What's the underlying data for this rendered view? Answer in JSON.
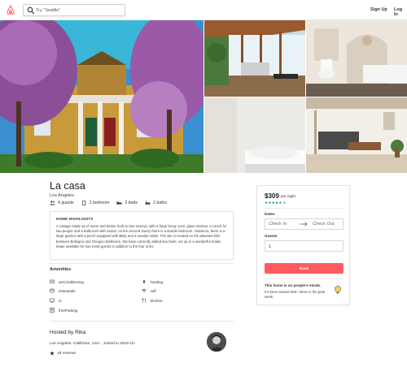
{
  "header": {
    "search_placeholder": "Try \"Seattle\"",
    "signup_label": "Sign Up",
    "login_label": "Log In"
  },
  "listing": {
    "title": "La casa",
    "city": "Los Angeles",
    "stats": {
      "guests": "4 guests",
      "bedrooms": "2 bedroom",
      "beds": "2 beds",
      "baths": "1 baths"
    },
    "highlights_title": "HOME HIGHLIGHTS",
    "highlights_text": "A cottage made up of stone and timber built on two storeys, with a large living room, glass window, a couch for two people and a bathroom with sauna; on the second storey there is a double bedroom. Outdoors, there is a large garden with a porch equipped with BBQ and a wooden table. The site is located on the pleasant hills between Bollegno and Ozegnio Biolbrone. We have currently added two beds, set up in a wonderful Indian leape available for two extra guests in addition to the four ones."
  },
  "amenities": {
    "title": "Amenities",
    "items": [
      {
        "label": "airConditioning",
        "icon": "snowflake-icon"
      },
      {
        "label": "heating",
        "icon": "heating-icon"
      },
      {
        "label": "essentials",
        "icon": "essentials-icon"
      },
      {
        "label": "wifi",
        "icon": "wifi-icon"
      },
      {
        "label": "tv",
        "icon": "tv-icon"
      },
      {
        "label": "kitchen",
        "icon": "kitchen-icon"
      },
      {
        "label": "freeParking",
        "icon": "parking-icon"
      }
    ]
  },
  "host": {
    "title": "Hosted by Rika",
    "location": "Los Angeles, California, USA · Joined in 2018-10-",
    "reviews": "18 reviews"
  },
  "booking": {
    "price": "$309",
    "per_night": "per night",
    "stars": "★★★★★",
    "review_count": "5",
    "dates_label": "Dates",
    "checkin": "Check In",
    "checkout": "Check Out",
    "guests_label": "Guests",
    "guests_value": "1",
    "book_label": "Book",
    "rare_title": "This home is on people's minds.",
    "rare_sub": "It's been viewed 500+ times in the past week."
  },
  "colors": {
    "brand": "#ff5a5f",
    "star": "#0e8a8a"
  }
}
